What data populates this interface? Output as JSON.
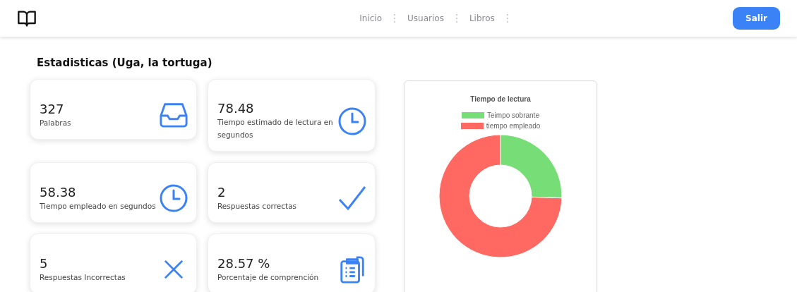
{
  "nav": {
    "links": [
      {
        "label": "Inicio"
      },
      {
        "label": "Usuarios"
      },
      {
        "label": "Libros"
      }
    ],
    "logout": "Salir"
  },
  "title": "Estadisticas (Uga, la tortuga)",
  "stats": [
    {
      "value": "327",
      "label": "Palabras",
      "kind": "inbox"
    },
    {
      "value": "78.48",
      "label": "Tiempo estimado de lectura en segundos",
      "kind": "clock"
    },
    {
      "value": "58.38",
      "label": "Tiempo empleado en segundos",
      "kind": "clock"
    },
    {
      "value": "2",
      "label": "Respuestas correctas",
      "kind": "check"
    },
    {
      "value": "5",
      "label": "Respuestas Incorrectas",
      "kind": "cross"
    },
    {
      "value": "28.57 %",
      "label": "Porcentaje de comprención",
      "kind": "clipboard"
    }
  ],
  "chart": {
    "title": "Tiempo de lectura",
    "legend": [
      {
        "label": "Teimpo sobrante",
        "color": "#77dd77"
      },
      {
        "label": "tiempo empleado",
        "color": "#ff6961"
      }
    ]
  }
}
